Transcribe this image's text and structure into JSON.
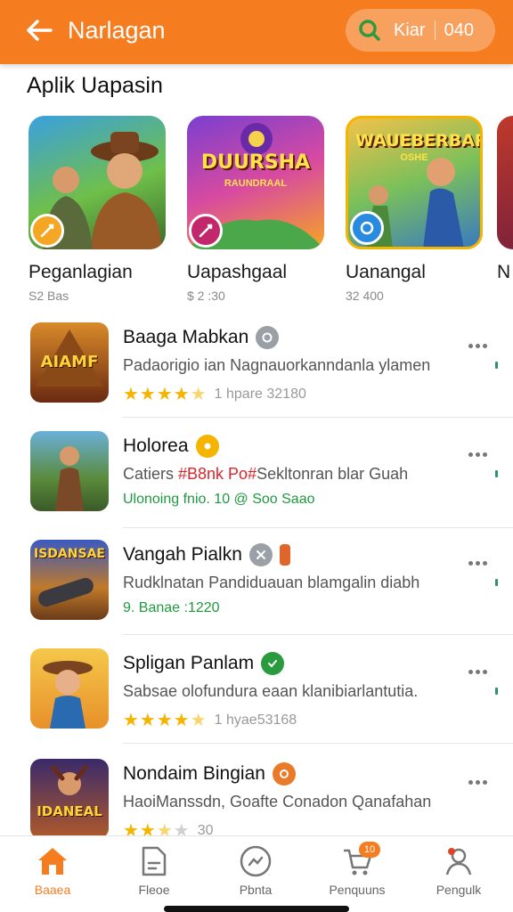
{
  "header": {
    "title": "Narlagan",
    "search_text": "Kiar",
    "search_count": "040"
  },
  "featured": {
    "title": "Aplik Uapasin",
    "items": [
      {
        "name": "Peganlagian",
        "meta": "S2 Bas",
        "tile_text": "",
        "tile_sub": ""
      },
      {
        "name": "Uapashgaal",
        "meta": "$ 2 :30",
        "tile_text": "DUURSHA",
        "tile_sub": "RAUNDRAAL"
      },
      {
        "name": "Uanangal",
        "meta": "32 400",
        "tile_text": "WAUEBERBAR",
        "tile_sub": "OSHE"
      },
      {
        "name": "N",
        "meta": ""
      }
    ]
  },
  "list": [
    {
      "title": "Baaga Mabkan",
      "desc": "Padaorigio ian Nagnauorkanndanla ylamen",
      "rating": 4.5,
      "sub_text": "1 hpare 32180",
      "icon_text": "AIAMF"
    },
    {
      "title": "Holorea",
      "desc_part1": "Catiers ",
      "desc_red": "#B8nk Po#",
      "desc_part2": "Sekltonran blar Guah",
      "sub_text": "Ulonoing fnio.  10 @ Soo Saao",
      "icon_text": ""
    },
    {
      "title": "Vangah Pialkn",
      "desc": "Rudklnatan Pandiduauan blamgalin diabh",
      "sub_text": "9. Banae :1220",
      "icon_text": "ISDANSAE"
    },
    {
      "title": "Spligan Panlam",
      "desc": "Sabsae olofundura eaan klanibiarlantutia.",
      "rating": 4.5,
      "sub_text": "1 hyae53168",
      "icon_text": ""
    },
    {
      "title": "Nondaim Bingian",
      "desc": "HaoiManssdn, Goafte Conadon Qanafahan",
      "rating": 2.5,
      "sub_text": "30",
      "icon_text": "IDANEAL"
    }
  ],
  "bottom_nav": [
    {
      "label": "Baaea",
      "active": true,
      "icon": "home-icon"
    },
    {
      "label": "Fleoe",
      "active": false,
      "icon": "document-icon"
    },
    {
      "label": "Pbnta",
      "active": false,
      "icon": "compass-icon"
    },
    {
      "label": "Penquuns",
      "active": false,
      "icon": "cart-icon",
      "badge": "10"
    },
    {
      "label": "Pengulk",
      "active": false,
      "icon": "profile-icon"
    }
  ],
  "colors": {
    "brand": "#f57c1f",
    "star": "#f5b400",
    "green": "#1e9a3e",
    "red": "#d9262b"
  }
}
